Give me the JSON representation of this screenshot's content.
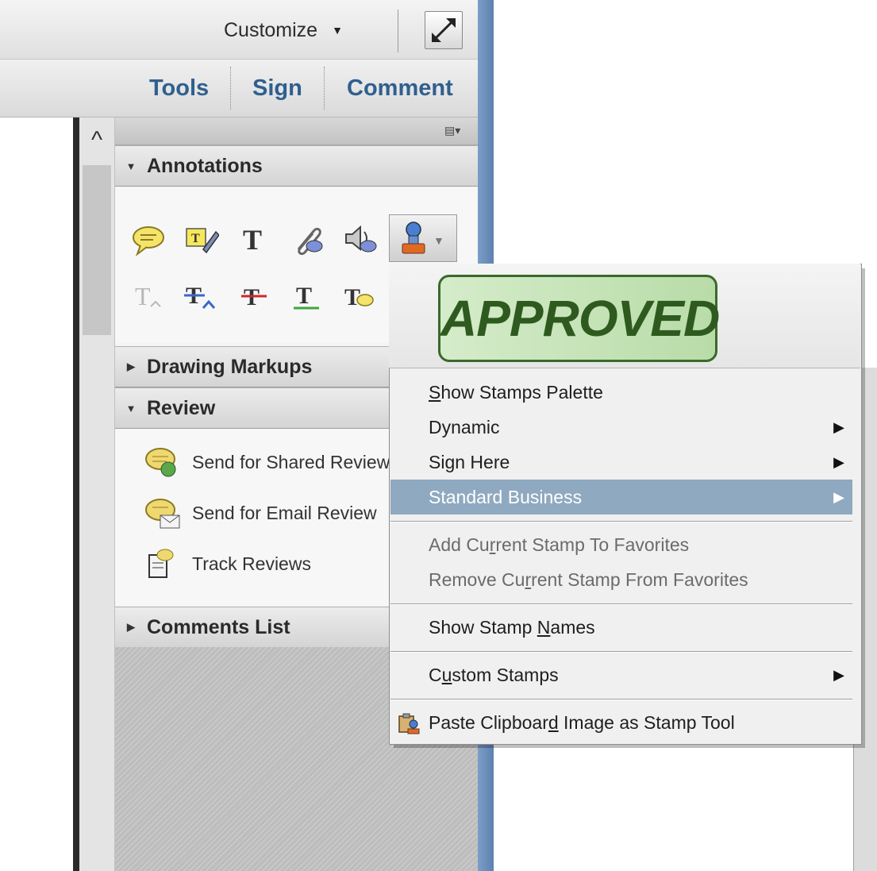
{
  "toolbar": {
    "customize_label": "Customize",
    "tabs": [
      {
        "label": "Tools"
      },
      {
        "label": "Sign"
      },
      {
        "label": "Comment"
      }
    ]
  },
  "panel": {
    "sections": {
      "annotations": {
        "title": "Annotations",
        "expanded": true
      },
      "drawing_markups": {
        "title": "Drawing Markups",
        "expanded": false
      },
      "review": {
        "title": "Review",
        "expanded": true
      },
      "comments_list": {
        "title": "Comments List",
        "expanded": false
      }
    },
    "annotation_tools_row1": [
      "sticky-note-icon",
      "highlight-text-icon",
      "add-text-icon",
      "attach-file-icon",
      "record-audio-icon",
      "stamp-icon"
    ],
    "annotation_tools_row2": [
      "insert-text-icon",
      "replace-text-icon",
      "strikethrough-icon",
      "underline-icon",
      "text-comment-icon"
    ],
    "review_items": [
      {
        "label": "Send for Shared Review",
        "icon": "shared-review-icon"
      },
      {
        "label": "Send for Email Review",
        "icon": "email-review-icon"
      },
      {
        "label": "Track Reviews",
        "icon": "track-reviews-icon"
      }
    ]
  },
  "stamp_menu": {
    "preview_text": "APPROVED",
    "items": {
      "show_palette": {
        "pre": "",
        "ul": "S",
        "post": "how Stamps Palette"
      },
      "dynamic": "Dynamic",
      "sign_here": "Sign Here",
      "standard_business": "Standard Business",
      "add_favorites": {
        "pre": "Add Cu",
        "ul": "r",
        "post": "rent Stamp To Favorites"
      },
      "remove_favorites": {
        "pre": "Remove Cu",
        "ul": "r",
        "post": "rent Stamp From Favorites"
      },
      "show_names": {
        "pre": "Show Stamp ",
        "ul": "N",
        "post": "ames"
      },
      "custom_stamps": {
        "pre": "C",
        "ul": "u",
        "post": "stom Stamps"
      },
      "paste_clipboard": {
        "pre": "Paste Clipboar",
        "ul": "d",
        "post": " Image as Stamp Tool"
      }
    },
    "highlighted": "Standard Business"
  },
  "colors": {
    "tab_text": "#2f5f8f",
    "menu_highlight": "#8fa9c0",
    "panel_edge": "#6b8fbb",
    "approved_green": "#2f5a1f"
  }
}
